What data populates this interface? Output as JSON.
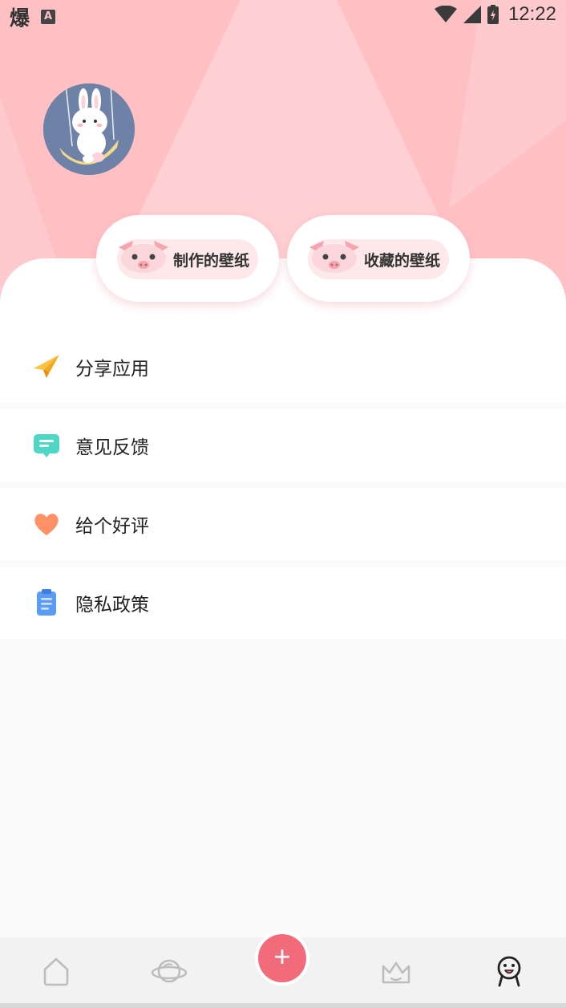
{
  "status_bar": {
    "app_char": "爆",
    "badge": "A",
    "time": "12:22"
  },
  "profile": {
    "avatar": "rabbit-on-swing-avatar"
  },
  "quick_actions": [
    {
      "label": "制作的壁纸",
      "icon": "pig-icon"
    },
    {
      "label": "收藏的壁纸",
      "icon": "pig-icon"
    }
  ],
  "menu": [
    {
      "label": "分享应用",
      "icon": "paper-plane-icon"
    },
    {
      "label": "意见反馈",
      "icon": "chat-bubble-icon"
    },
    {
      "label": "给个好评",
      "icon": "heart-icon"
    },
    {
      "label": "隐私政策",
      "icon": "clipboard-icon"
    }
  ],
  "tabbar": {
    "tabs": [
      {
        "name": "home",
        "icon": "home-icon"
      },
      {
        "name": "explore",
        "icon": "planet-icon"
      },
      {
        "name": "create",
        "icon": "plus-icon",
        "label": "+"
      },
      {
        "name": "vip",
        "icon": "crown-icon"
      },
      {
        "name": "mine",
        "icon": "face-icon",
        "active": true
      }
    ]
  },
  "colors": {
    "hero": "#ffc0c4",
    "accent": "#f26b7a",
    "card": "#ffffff",
    "pill": "#fde9ea"
  }
}
